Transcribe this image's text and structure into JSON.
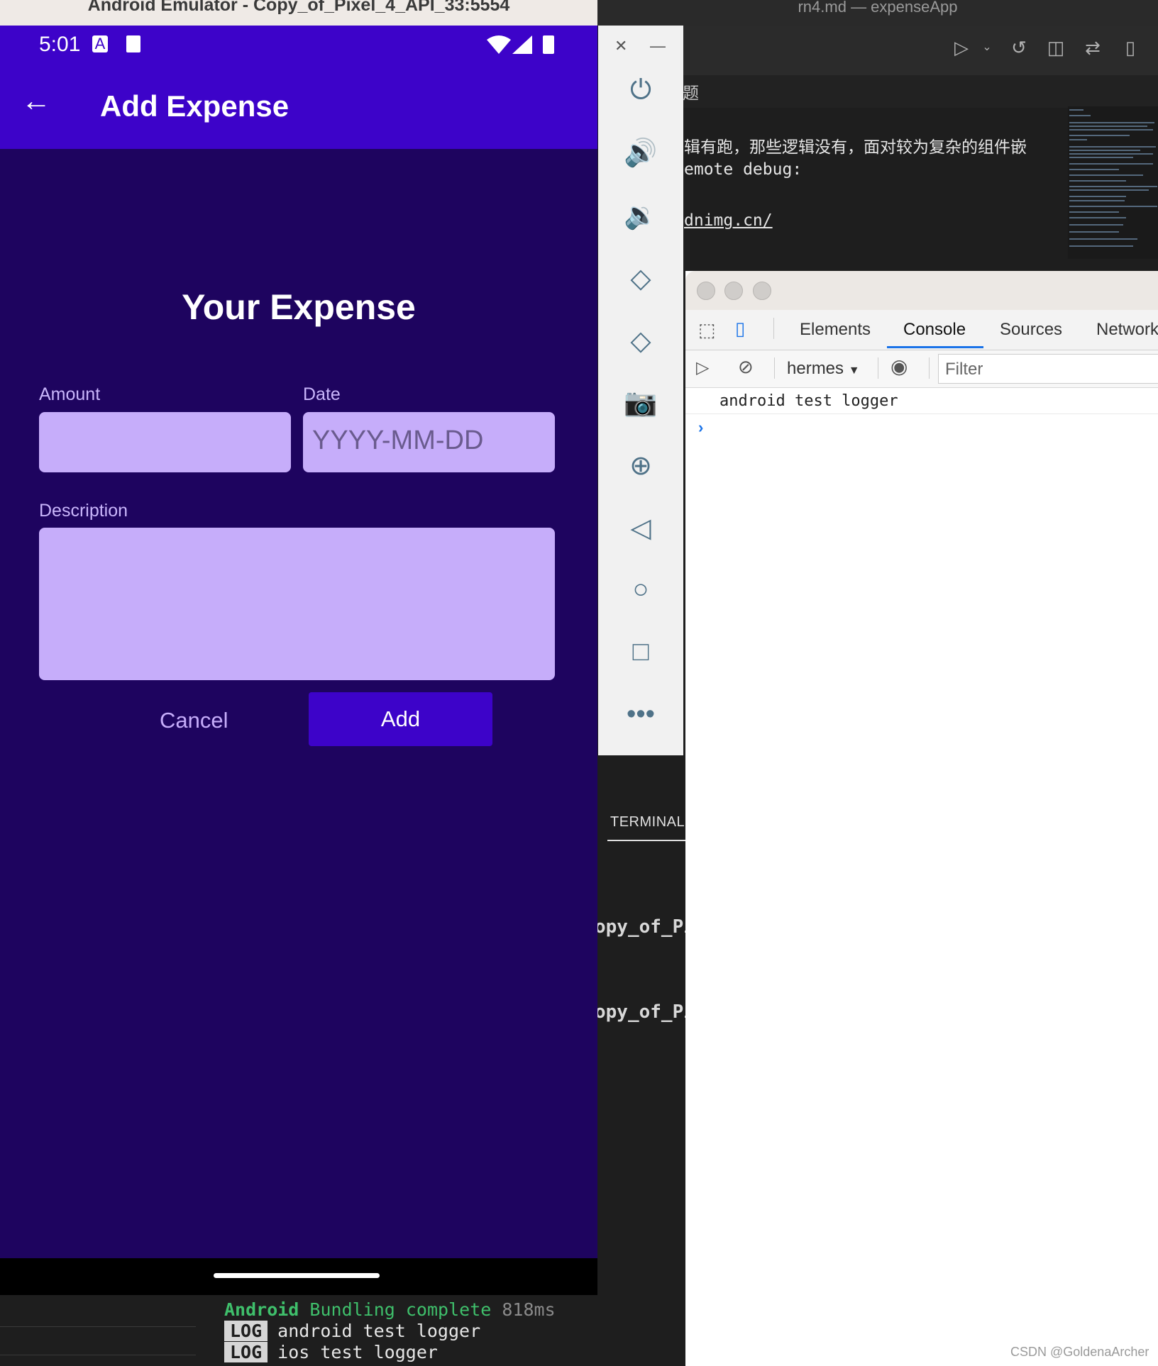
{
  "emulator": {
    "window_title": "Android Emulator - Copy_of_Pixel_4_API_33:5554",
    "status_time": "5:01",
    "app_bar_title": "Add Expense",
    "form_title": "Your Expense",
    "amount_label": "Amount",
    "date_label": "Date",
    "date_placeholder": "YYYY-MM-DD",
    "description_label": "Description",
    "cancel_label": "Cancel",
    "add_label": "Add",
    "colors": {
      "app_bar": "#3d03c9",
      "background": "#1e045f",
      "input": "#c6adfa"
    }
  },
  "side_toolbar": {
    "icons": [
      "close-icon",
      "minimize-icon",
      "power-icon",
      "volume-up-icon",
      "volume-down-icon",
      "rotate-left-icon",
      "rotate-right-icon",
      "camera-icon",
      "zoom-icon",
      "back-icon",
      "home-icon",
      "overview-icon",
      "more-icon"
    ]
  },
  "vscode": {
    "window_title": "rn4.md — expenseApp",
    "tab_text": "题",
    "editor_lines": [
      "辑有跑，那些逻辑没有，面对较为复杂的组件嵌",
      "emote debug:",
      "dnimg.cn/"
    ],
    "terminal_tab": "TERMINAL",
    "terminal_lines": [
      "opy_of_Pi",
      "opy_of_Pi"
    ],
    "log": {
      "bundling_platform": "Android",
      "bundling_text": "Bundling complete",
      "bundling_time": "818ms",
      "lines": [
        {
          "level": "LOG",
          "text": "android test logger"
        },
        {
          "level": "LOG",
          "text": "ios test logger"
        }
      ]
    }
  },
  "devtools": {
    "tabs": [
      "Elements",
      "Console",
      "Sources",
      "Network"
    ],
    "active_tab": "Console",
    "context": "hermes",
    "filter_placeholder": "Filter",
    "console_lines": [
      "android test logger"
    ]
  },
  "watermark": "CSDN @GoldenaArcher"
}
